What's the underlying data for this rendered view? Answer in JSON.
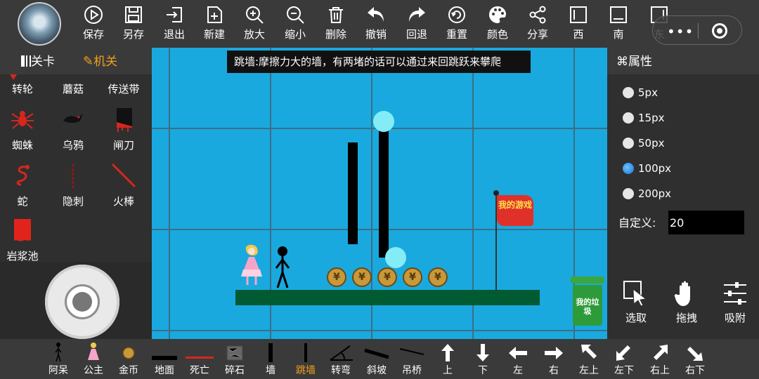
{
  "toolbar": {
    "items": [
      {
        "label": "保存",
        "icon": "play-circle-icon"
      },
      {
        "label": "另存",
        "icon": "floppy-icon"
      },
      {
        "label": "退出",
        "icon": "exit-icon"
      },
      {
        "label": "新建",
        "icon": "new-file-icon"
      },
      {
        "label": "放大",
        "icon": "zoom-in-icon"
      },
      {
        "label": "缩小",
        "icon": "zoom-out-icon"
      },
      {
        "label": "删除",
        "icon": "trash-icon"
      },
      {
        "label": "撤销",
        "icon": "undo-icon"
      },
      {
        "label": "回退",
        "icon": "redo-icon"
      },
      {
        "label": "重置",
        "icon": "reset-icon"
      },
      {
        "label": "颜色",
        "icon": "palette-icon"
      },
      {
        "label": "分享",
        "icon": "share-icon"
      },
      {
        "label": "西",
        "icon": "align-west-icon"
      },
      {
        "label": "南",
        "icon": "align-south-icon"
      },
      {
        "label": "东",
        "icon": "align-east-icon"
      }
    ]
  },
  "left_panel": {
    "tab_level": "关卡",
    "tab_mechanism": "机关",
    "items": [
      {
        "label": "转轮",
        "icon": "wheel-icon"
      },
      {
        "label": "蘑菇",
        "icon": "mushroom-icon"
      },
      {
        "label": "传送带",
        "icon": "conveyor-icon"
      },
      {
        "label": "蜘蛛",
        "icon": "spider-icon"
      },
      {
        "label": "乌鸦",
        "icon": "crow-icon"
      },
      {
        "label": "闸刀",
        "icon": "guillotine-icon"
      },
      {
        "label": "蛇",
        "icon": "snake-icon"
      },
      {
        "label": "隐刺",
        "icon": "hidden-spike-icon"
      },
      {
        "label": "火棒",
        "icon": "fire-stick-icon"
      },
      {
        "label": "岩浆池",
        "icon": "lava-pool-icon"
      }
    ]
  },
  "canvas": {
    "tip": "跳墙:摩擦力大的墙，有两堵的话可以通过来回跳跃来攀爬",
    "flag_text": "我的游戏",
    "trash_text": "我的垃圾",
    "coin_symbol": "¥",
    "background_color": "#19a9de"
  },
  "right_panel": {
    "title": "⌘属性",
    "options": [
      "5px",
      "15px",
      "50px",
      "100px",
      "200px"
    ],
    "selected_option": "100px",
    "custom_label": "自定义:",
    "custom_value": "20",
    "tools": [
      {
        "label": "选取",
        "icon": "select-cursor-icon"
      },
      {
        "label": "拖拽",
        "icon": "drag-hand-icon"
      },
      {
        "label": "吸附",
        "icon": "snap-sliders-icon"
      }
    ]
  },
  "bottom_bar": {
    "items": [
      {
        "label": "阿呆",
        "icon": "stickman-icon"
      },
      {
        "label": "公主",
        "icon": "princess-icon"
      },
      {
        "label": "金币",
        "icon": "coin-icon"
      },
      {
        "label": "地面",
        "icon": "ground-icon"
      },
      {
        "label": "死亡",
        "icon": "death-line-icon"
      },
      {
        "label": "碎石",
        "icon": "rubble-icon"
      },
      {
        "label": "墙",
        "icon": "wall-icon"
      },
      {
        "label": "跳墙",
        "icon": "jump-wall-icon"
      },
      {
        "label": "转弯",
        "icon": "turn-icon"
      },
      {
        "label": "斜坡",
        "icon": "slope-icon"
      },
      {
        "label": "吊桥",
        "icon": "drawbridge-icon"
      },
      {
        "label": "上",
        "icon": "arrow-up-icon"
      },
      {
        "label": "下",
        "icon": "arrow-down-icon"
      },
      {
        "label": "左",
        "icon": "arrow-left-icon"
      },
      {
        "label": "右",
        "icon": "arrow-right-icon"
      },
      {
        "label": "左上",
        "icon": "arrow-up-left-icon"
      },
      {
        "label": "左下",
        "icon": "arrow-down-left-icon"
      },
      {
        "label": "右上",
        "icon": "arrow-up-right-icon"
      },
      {
        "label": "右下",
        "icon": "arrow-down-right-icon"
      }
    ],
    "selected": "跳墙"
  },
  "colors": {
    "accent": "#f0a01c",
    "canvas_bg": "#19a9de",
    "ground": "#005a32",
    "ball": "#84ecf6",
    "flag": "#e0302a"
  }
}
